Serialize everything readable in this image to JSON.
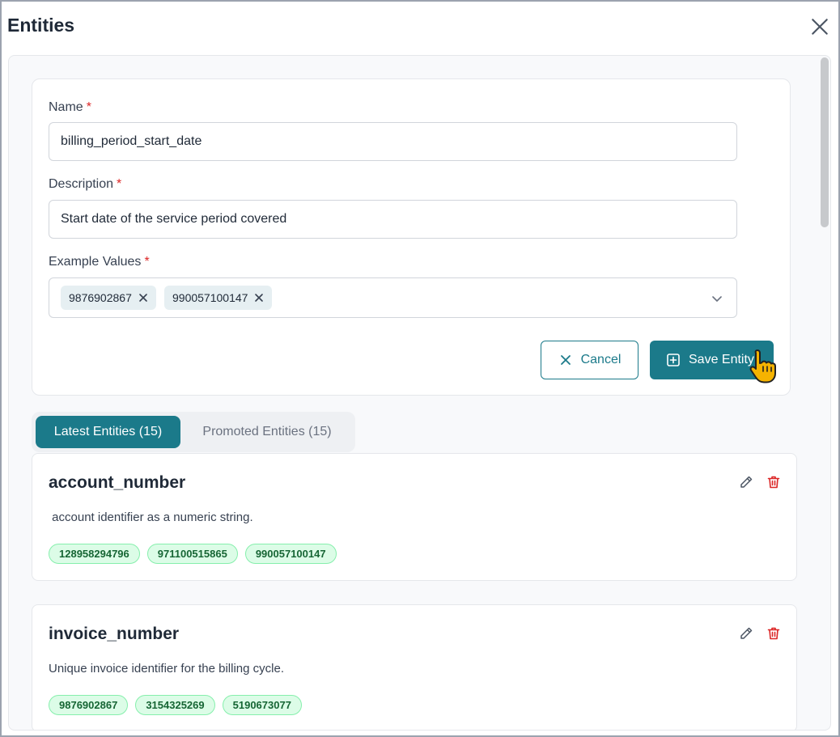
{
  "dialog": {
    "title": "Entities",
    "close_icon": "close-icon"
  },
  "form": {
    "name_label": "Name",
    "name_value": "billing_period_start_date",
    "description_label": "Description",
    "description_value": "Start date of the service period covered",
    "examples_label": "Example Values",
    "required_mark": "*",
    "example_tags": [
      "9876902867",
      "990057100147"
    ],
    "cancel_label": "Cancel",
    "save_label": "Save Entity"
  },
  "tabs": {
    "latest_label": "Latest Entities (15)",
    "promoted_label": "Promoted Entities (15)",
    "active": "latest"
  },
  "entities": [
    {
      "name": "account_number",
      "description": " account identifier as a numeric string.",
      "values": [
        "128958294796",
        "971100515865",
        "990057100147"
      ]
    },
    {
      "name": "invoice_number",
      "description": "Unique invoice identifier for the billing cycle.",
      "values": [
        "9876902867",
        "3154325269",
        "5190673077"
      ]
    }
  ],
  "colors": {
    "accent": "#1b7a8a",
    "required": "#dc2626",
    "chip_bg": "#dcfce7",
    "chip_text": "#166534",
    "delete": "#dc2626"
  }
}
